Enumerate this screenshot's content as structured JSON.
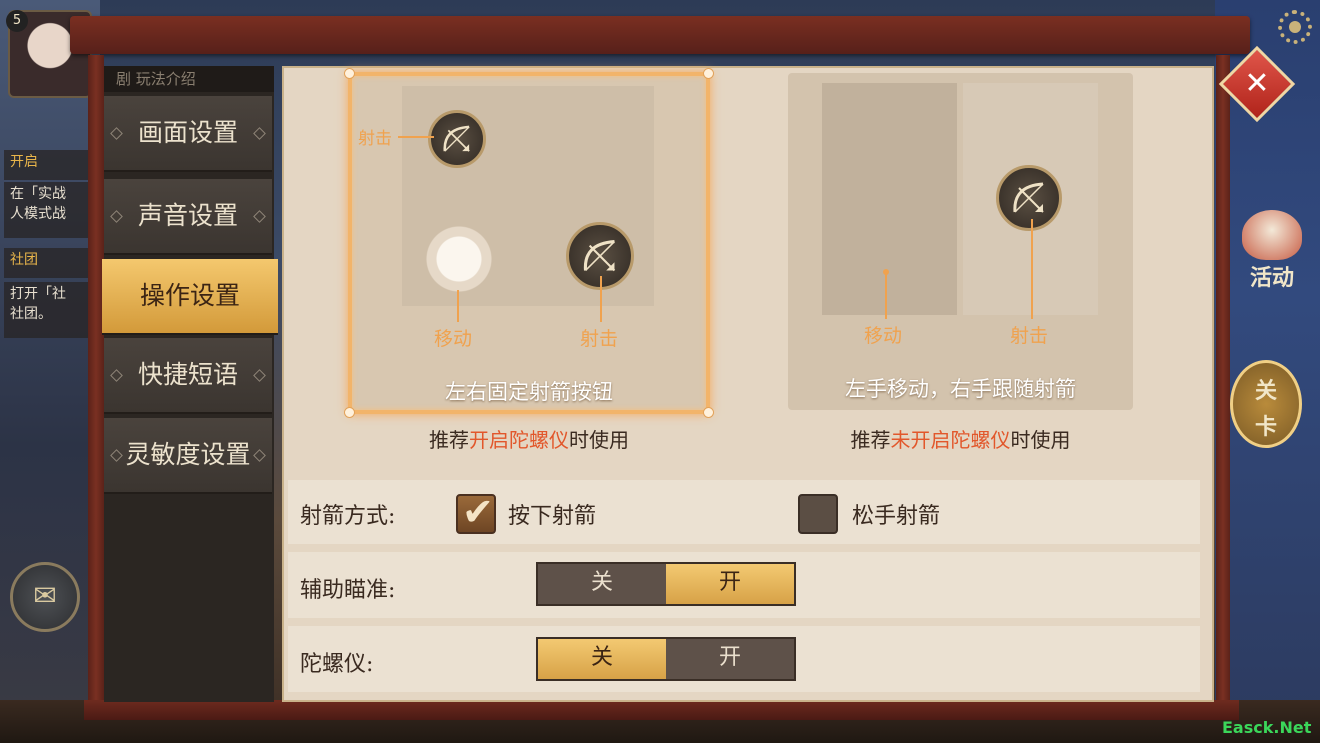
{
  "player": {
    "level": "5"
  },
  "bg_notes": {
    "note1": "在「实战\n人模式战",
    "note2": "打开「社\n社团。",
    "tag1": "开启",
    "tag2": "社团"
  },
  "sidebar": {
    "header": "剧 玩法介绍",
    "items": [
      {
        "label": "画面设置"
      },
      {
        "label": "声音设置"
      },
      {
        "label": "操作设置"
      },
      {
        "label": "快捷短语"
      },
      {
        "label": "灵敏度设置"
      }
    ],
    "active_index": 2
  },
  "right_panel": {
    "activity": "活动",
    "level": "关\n卡"
  },
  "modes": {
    "fixed": {
      "title": "左右固定射箭按钮",
      "shoot_label_top": "射击",
      "move_label": "移动",
      "shoot_label": "射击",
      "recommend_prefix": "推荐",
      "recommend_highlight": "开启陀螺仪",
      "recommend_suffix": "时使用",
      "selected": true
    },
    "follow": {
      "title": "左手移动，右手跟随射箭",
      "move_label": "移动",
      "shoot_label": "射击",
      "recommend_prefix": "推荐",
      "recommend_highlight": "未开启陀螺仪",
      "recommend_suffix": "时使用",
      "selected": false
    }
  },
  "settings": {
    "shoot_mode": {
      "label": "射箭方式:",
      "options": [
        {
          "label": "按下射箭",
          "checked": true
        },
        {
          "label": "松手射箭",
          "checked": false
        }
      ]
    },
    "aim_assist": {
      "label": "辅助瞄准:",
      "off": "关",
      "on": "开",
      "value": "on"
    },
    "gyroscope": {
      "label": "陀螺仪:",
      "off": "关",
      "on": "开",
      "value": "off"
    }
  },
  "watermark": "Easck.Net",
  "colors": {
    "accent": "#f0a24e",
    "highlight": "#e2572b",
    "active_tab": "#e6ad52"
  }
}
